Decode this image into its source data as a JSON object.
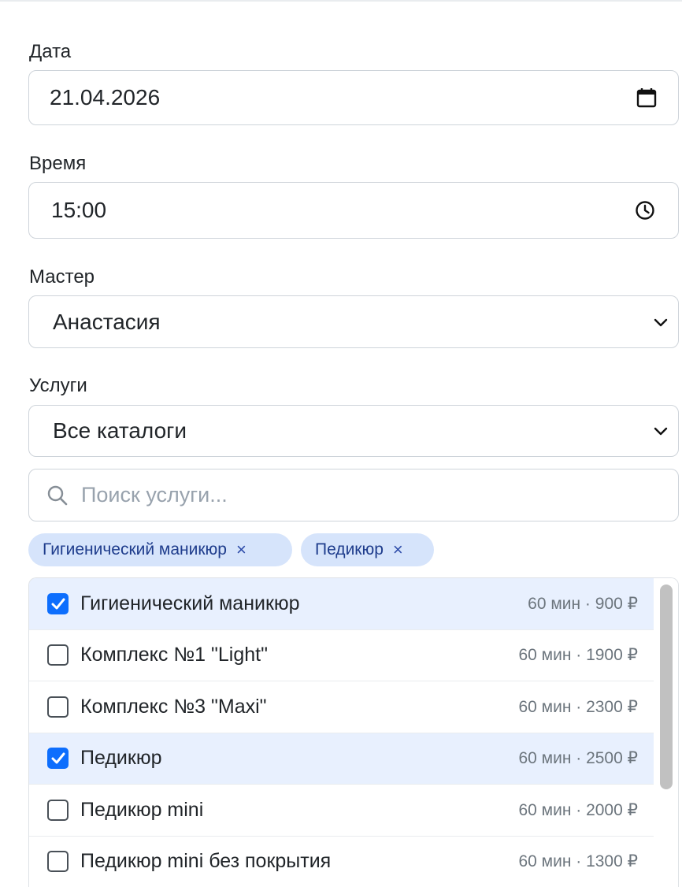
{
  "form": {
    "date": {
      "label": "Дата",
      "value": "21.04.2026"
    },
    "time": {
      "label": "Время",
      "value": "15:00"
    },
    "master": {
      "label": "Мастер",
      "value": "Анастасия"
    },
    "services": {
      "label": "Услуги",
      "catalog_value": "Все каталоги"
    },
    "search": {
      "placeholder": "Поиск услуги..."
    }
  },
  "chips": [
    {
      "label": "Гигиенический маникюр",
      "close": "×"
    },
    {
      "label": "Педикюр",
      "close": "×"
    }
  ],
  "service_list": [
    {
      "name": "Гигиенический маникюр",
      "meta": "60 мин · 900 ₽",
      "checked": true
    },
    {
      "name": "Комплекс №1 \"Light\"",
      "meta": "60 мин · 1900 ₽",
      "checked": false
    },
    {
      "name": "Комплекс №3 \"Maxi\"",
      "meta": "60 мин · 2300 ₽",
      "checked": false
    },
    {
      "name": "Педикюр",
      "meta": "60 мин · 2500 ₽",
      "checked": true
    },
    {
      "name": "Педикюр mini",
      "meta": "60 мин · 2000 ₽",
      "checked": false
    },
    {
      "name": "Педикюр mini без покрытия",
      "meta": "60 мин · 1300 ₽",
      "checked": false
    }
  ],
  "colors": {
    "accent": "#0d6efd",
    "chip_bg": "#d6e4fb",
    "chip_text": "#1e3c8c"
  }
}
